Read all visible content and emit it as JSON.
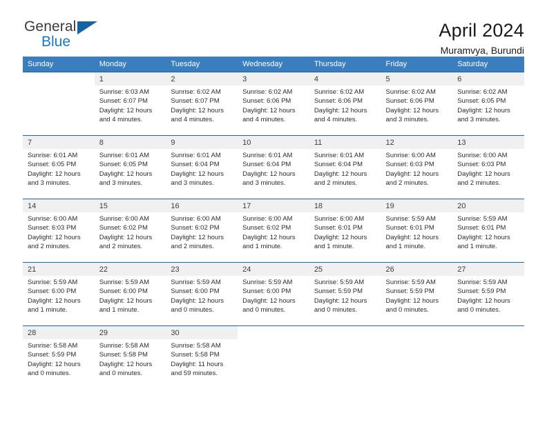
{
  "brand": {
    "name_top": "General",
    "name_bottom": "Blue",
    "flag_color": "#1464a5",
    "blue_color": "#1878c8"
  },
  "header": {
    "title": "April 2024",
    "subtitle": "Muramvya, Burundi"
  },
  "theme": {
    "header_blue": "#3b7ebf",
    "separator_blue": "#1f62ac",
    "daynum_gray": "#f0f0f0"
  },
  "calendar": {
    "weekdays": [
      "Sunday",
      "Monday",
      "Tuesday",
      "Wednesday",
      "Thursday",
      "Friday",
      "Saturday"
    ],
    "weeks": [
      [
        {
          "day": "",
          "lines": []
        },
        {
          "day": "1",
          "lines": [
            "Sunrise: 6:03 AM",
            "Sunset: 6:07 PM",
            "Daylight: 12 hours",
            "and 4 minutes."
          ]
        },
        {
          "day": "2",
          "lines": [
            "Sunrise: 6:02 AM",
            "Sunset: 6:07 PM",
            "Daylight: 12 hours",
            "and 4 minutes."
          ]
        },
        {
          "day": "3",
          "lines": [
            "Sunrise: 6:02 AM",
            "Sunset: 6:06 PM",
            "Daylight: 12 hours",
            "and 4 minutes."
          ]
        },
        {
          "day": "4",
          "lines": [
            "Sunrise: 6:02 AM",
            "Sunset: 6:06 PM",
            "Daylight: 12 hours",
            "and 4 minutes."
          ]
        },
        {
          "day": "5",
          "lines": [
            "Sunrise: 6:02 AM",
            "Sunset: 6:06 PM",
            "Daylight: 12 hours",
            "and 3 minutes."
          ]
        },
        {
          "day": "6",
          "lines": [
            "Sunrise: 6:02 AM",
            "Sunset: 6:05 PM",
            "Daylight: 12 hours",
            "and 3 minutes."
          ]
        }
      ],
      [
        {
          "day": "7",
          "lines": [
            "Sunrise: 6:01 AM",
            "Sunset: 6:05 PM",
            "Daylight: 12 hours",
            "and 3 minutes."
          ]
        },
        {
          "day": "8",
          "lines": [
            "Sunrise: 6:01 AM",
            "Sunset: 6:05 PM",
            "Daylight: 12 hours",
            "and 3 minutes."
          ]
        },
        {
          "day": "9",
          "lines": [
            "Sunrise: 6:01 AM",
            "Sunset: 6:04 PM",
            "Daylight: 12 hours",
            "and 3 minutes."
          ]
        },
        {
          "day": "10",
          "lines": [
            "Sunrise: 6:01 AM",
            "Sunset: 6:04 PM",
            "Daylight: 12 hours",
            "and 3 minutes."
          ]
        },
        {
          "day": "11",
          "lines": [
            "Sunrise: 6:01 AM",
            "Sunset: 6:04 PM",
            "Daylight: 12 hours",
            "and 2 minutes."
          ]
        },
        {
          "day": "12",
          "lines": [
            "Sunrise: 6:00 AM",
            "Sunset: 6:03 PM",
            "Daylight: 12 hours",
            "and 2 minutes."
          ]
        },
        {
          "day": "13",
          "lines": [
            "Sunrise: 6:00 AM",
            "Sunset: 6:03 PM",
            "Daylight: 12 hours",
            "and 2 minutes."
          ]
        }
      ],
      [
        {
          "day": "14",
          "lines": [
            "Sunrise: 6:00 AM",
            "Sunset: 6:03 PM",
            "Daylight: 12 hours",
            "and 2 minutes."
          ]
        },
        {
          "day": "15",
          "lines": [
            "Sunrise: 6:00 AM",
            "Sunset: 6:02 PM",
            "Daylight: 12 hours",
            "and 2 minutes."
          ]
        },
        {
          "day": "16",
          "lines": [
            "Sunrise: 6:00 AM",
            "Sunset: 6:02 PM",
            "Daylight: 12 hours",
            "and 2 minutes."
          ]
        },
        {
          "day": "17",
          "lines": [
            "Sunrise: 6:00 AM",
            "Sunset: 6:02 PM",
            "Daylight: 12 hours",
            "and 1 minute."
          ]
        },
        {
          "day": "18",
          "lines": [
            "Sunrise: 6:00 AM",
            "Sunset: 6:01 PM",
            "Daylight: 12 hours",
            "and 1 minute."
          ]
        },
        {
          "day": "19",
          "lines": [
            "Sunrise: 5:59 AM",
            "Sunset: 6:01 PM",
            "Daylight: 12 hours",
            "and 1 minute."
          ]
        },
        {
          "day": "20",
          "lines": [
            "Sunrise: 5:59 AM",
            "Sunset: 6:01 PM",
            "Daylight: 12 hours",
            "and 1 minute."
          ]
        }
      ],
      [
        {
          "day": "21",
          "lines": [
            "Sunrise: 5:59 AM",
            "Sunset: 6:00 PM",
            "Daylight: 12 hours",
            "and 1 minute."
          ]
        },
        {
          "day": "22",
          "lines": [
            "Sunrise: 5:59 AM",
            "Sunset: 6:00 PM",
            "Daylight: 12 hours",
            "and 1 minute."
          ]
        },
        {
          "day": "23",
          "lines": [
            "Sunrise: 5:59 AM",
            "Sunset: 6:00 PM",
            "Daylight: 12 hours",
            "and 0 minutes."
          ]
        },
        {
          "day": "24",
          "lines": [
            "Sunrise: 5:59 AM",
            "Sunset: 6:00 PM",
            "Daylight: 12 hours",
            "and 0 minutes."
          ]
        },
        {
          "day": "25",
          "lines": [
            "Sunrise: 5:59 AM",
            "Sunset: 5:59 PM",
            "Daylight: 12 hours",
            "and 0 minutes."
          ]
        },
        {
          "day": "26",
          "lines": [
            "Sunrise: 5:59 AM",
            "Sunset: 5:59 PM",
            "Daylight: 12 hours",
            "and 0 minutes."
          ]
        },
        {
          "day": "27",
          "lines": [
            "Sunrise: 5:59 AM",
            "Sunset: 5:59 PM",
            "Daylight: 12 hours",
            "and 0 minutes."
          ]
        }
      ],
      [
        {
          "day": "28",
          "lines": [
            "Sunrise: 5:58 AM",
            "Sunset: 5:59 PM",
            "Daylight: 12 hours",
            "and 0 minutes."
          ]
        },
        {
          "day": "29",
          "lines": [
            "Sunrise: 5:58 AM",
            "Sunset: 5:58 PM",
            "Daylight: 12 hours",
            "and 0 minutes."
          ]
        },
        {
          "day": "30",
          "lines": [
            "Sunrise: 5:58 AM",
            "Sunset: 5:58 PM",
            "Daylight: 11 hours",
            "and 59 minutes."
          ]
        },
        {
          "day": "",
          "lines": []
        },
        {
          "day": "",
          "lines": []
        },
        {
          "day": "",
          "lines": []
        },
        {
          "day": "",
          "lines": []
        }
      ]
    ]
  }
}
